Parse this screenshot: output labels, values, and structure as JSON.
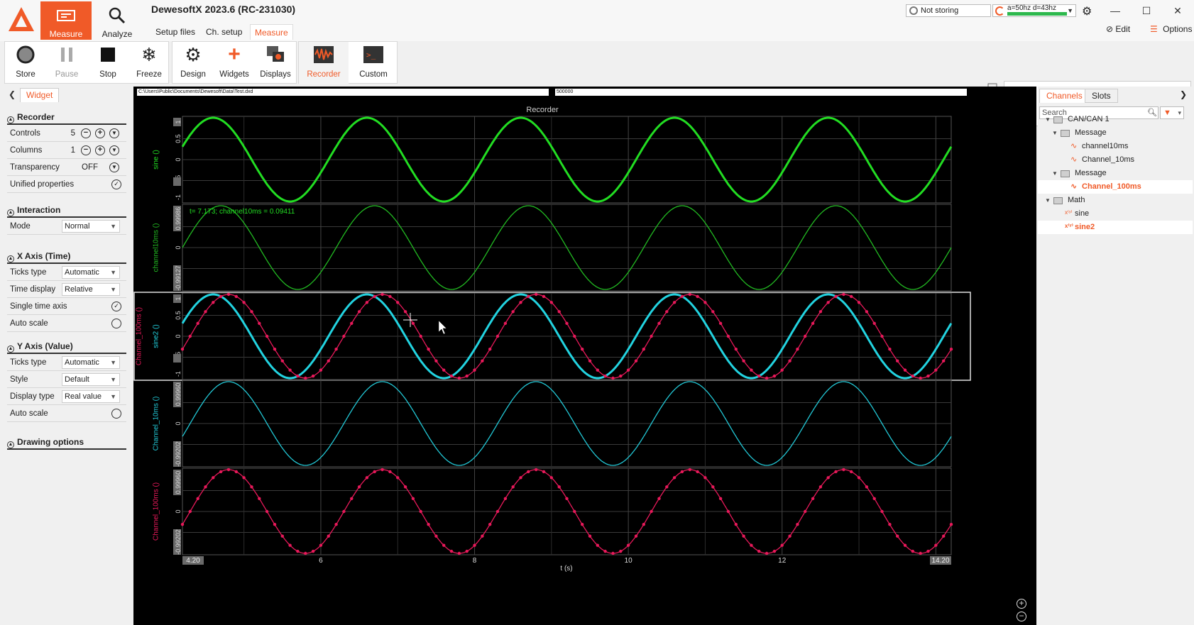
{
  "window": {
    "title": "DewesoftX 2023.6 (RC-231030)",
    "storing_status": "Not storing",
    "info_text": "a=50hz d=43hz",
    "edit_label": "Edit",
    "options_label": "Options"
  },
  "main_tabs": {
    "measure": "Measure",
    "analyze": "Analyze"
  },
  "sub_tabs": {
    "setup_files": "Setup files",
    "ch_setup": "Ch. setup",
    "measure": "Measure"
  },
  "toolbar": {
    "store": "Store",
    "pause": "Pause",
    "stop": "Stop",
    "freeze": "Freeze",
    "design": "Design",
    "widgets": "Widgets",
    "displays": "Displays",
    "recorder": "Recorder",
    "custom": "Custom"
  },
  "left_panel": {
    "tab": "Widget",
    "recorder": {
      "title": "Recorder",
      "controls_label": "Controls",
      "controls_value": "5",
      "columns_label": "Columns",
      "columns_value": "1",
      "transparency_label": "Transparency",
      "transparency_value": "OFF",
      "unified_label": "Unified properties"
    },
    "interaction": {
      "title": "Interaction",
      "mode_label": "Mode",
      "mode_value": "Normal"
    },
    "x_axis": {
      "title": "X Axis (Time)",
      "ticks_label": "Ticks type",
      "ticks_value": "Automatic",
      "time_display_label": "Time display",
      "time_display_value": "Relative",
      "single_time_label": "Single time axis",
      "auto_scale_label": "Auto scale"
    },
    "y_axis": {
      "title": "Y Axis (Value)",
      "ticks_label": "Ticks type",
      "ticks_value": "Automatic",
      "style_label": "Style",
      "style_value": "Default",
      "display_type_label": "Display type",
      "display_type_value": "Real value",
      "auto_scale_label": "Auto scale"
    },
    "drawing": {
      "title": "Drawing options"
    }
  },
  "main_area": {
    "file_path": "C:\\Users\\Public\\Documents\\Dewesoft\\Data\\Test.dxd",
    "sample_count": "500000",
    "recorder_title": "Recorder",
    "cursor_readout": "t= 7.173; channel10ms = 0.09411",
    "xlabel": "t (s)",
    "x_start_label": "4.20",
    "x_end_label": "14.20"
  },
  "right_panel": {
    "tabs": {
      "channels": "Channels",
      "slots": "Slots"
    },
    "search_placeholder": "Search",
    "tree": [
      {
        "label": "CAN/CAN 1",
        "kind": "folder",
        "level": 0,
        "selected": false
      },
      {
        "label": "Message",
        "kind": "folder",
        "level": 1,
        "selected": false
      },
      {
        "label": "channel10ms",
        "kind": "signal",
        "level": 2,
        "selected": false
      },
      {
        "label": "Channel_10ms",
        "kind": "signal",
        "level": 2,
        "selected": false
      },
      {
        "label": "Message",
        "kind": "folder",
        "level": 1,
        "selected": false
      },
      {
        "label": "Channel_100ms",
        "kind": "signal",
        "level": 2,
        "selected": true
      },
      {
        "label": "Math",
        "kind": "folder",
        "level": 0,
        "selected": false
      },
      {
        "label": "sine",
        "kind": "math",
        "level": 1,
        "selected": false
      },
      {
        "label": "sine2",
        "kind": "math",
        "level": 1,
        "selected": true
      }
    ]
  },
  "colors": {
    "accent": "#f05a28",
    "green": "#22dd22",
    "cyan": "#22d3e0",
    "magenta": "#e8195a"
  },
  "chart_data": {
    "type": "line",
    "title": "Recorder",
    "xlabel": "t (s)",
    "xlim": [
      4.2,
      14.2
    ],
    "x_ticks": [
      "4.20",
      "6",
      "8",
      "10",
      "12",
      "14.20"
    ],
    "panels": [
      {
        "ylabels": [
          "sine ()"
        ],
        "y_ticks": [
          "1",
          "0.5",
          "0",
          "-0.5",
          "-1"
        ],
        "ylim": [
          -1,
          1
        ],
        "series": [
          {
            "name": "sine ()",
            "color": "#22dd22",
            "period": 2.0,
            "peak_t": 4.6,
            "amplitude": 1,
            "markers": false
          }
        ]
      },
      {
        "ylabels": [
          "channel10ms ()"
        ],
        "y_ticks": [
          "0.99986",
          "0",
          "-0.99127"
        ],
        "ylim": [
          -1,
          1
        ],
        "series": [
          {
            "name": "channel10ms ()",
            "color": "#22bb22",
            "period": 2.0,
            "peak_t": 6.7,
            "amplitude": 1,
            "markers": false
          }
        ]
      },
      {
        "ylabels": [
          "Channel_100ms ()",
          "sine2 ()"
        ],
        "y_ticks": [
          "1",
          "0.5",
          "0",
          "-0.5",
          "-1"
        ],
        "ylim": [
          -1,
          1
        ],
        "series": [
          {
            "name": "sine2 ()",
            "color": "#22d3e0",
            "period": 2.0,
            "peak_t": 4.6,
            "amplitude": 1,
            "markers": false
          },
          {
            "name": "Channel_100ms ()",
            "color": "#e8195a",
            "period": 2.0,
            "peak_t": 4.8,
            "amplitude": 1,
            "markers": true
          }
        ]
      },
      {
        "ylabels": [
          "Channel_10ms ()"
        ],
        "y_ticks": [
          "0.99960",
          "0",
          "-0.99202"
        ],
        "ylim": [
          -1,
          1
        ],
        "series": [
          {
            "name": "Channel_10ms ()",
            "color": "#22c8d6",
            "period": 2.0,
            "peak_t": 4.8,
            "amplitude": 1,
            "markers": false
          }
        ]
      },
      {
        "ylabels": [
          "Channel_100ms ()"
        ],
        "y_ticks": [
          "0.99960",
          "0",
          "-0.99202"
        ],
        "ylim": [
          -1,
          1
        ],
        "series": [
          {
            "name": "Channel_100ms ()",
            "color": "#e8195a",
            "period": 2.0,
            "peak_t": 4.8,
            "amplitude": 1,
            "markers": true
          }
        ]
      }
    ]
  }
}
